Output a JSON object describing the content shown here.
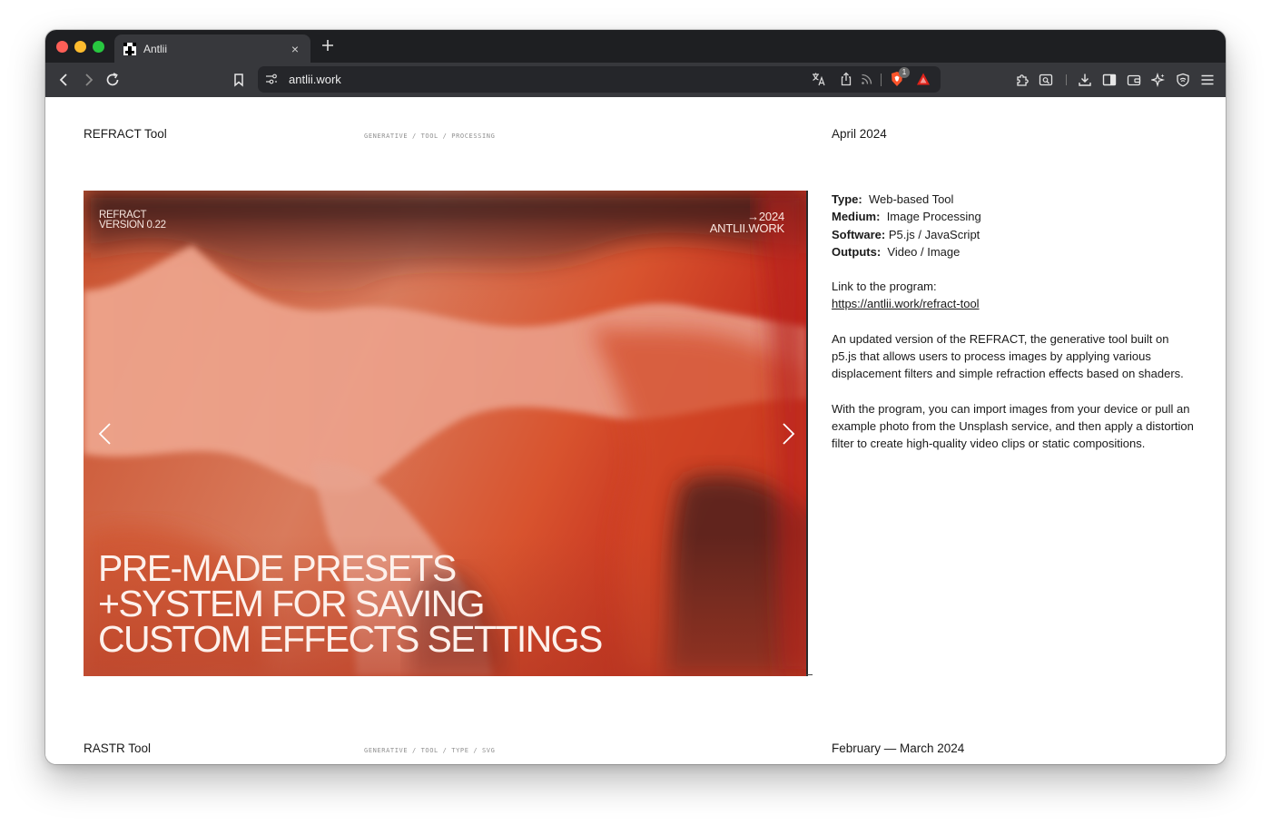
{
  "browser": {
    "tab_title": "Antlii",
    "tab_close": "×",
    "url": "antlii.work",
    "shields_badge": "1"
  },
  "projects": [
    {
      "title": "REFRACT Tool",
      "tags": "GENERATIVE / TOOL / PROCESSING",
      "date": "April 2024",
      "image": {
        "top_left_line1": "REFRACT",
        "top_left_line2": "VERSION 0.22",
        "top_right_line1": "→2024",
        "top_right_line2": "ANTLII.WORK",
        "headline_line1": "PRE-MADE PRESETS",
        "headline_line2": "+SYSTEM FOR SAVING",
        "headline_line3": "CUSTOM EFFECTS SETTINGS"
      },
      "specs": [
        {
          "label": "Type:",
          "value": "Web-based Tool"
        },
        {
          "label": "Medium:",
          "value": "Image Processing"
        },
        {
          "label": "Software:",
          "value": "P5.js / JavaScript"
        },
        {
          "label": "Outputs:",
          "value": "Video / Image"
        }
      ],
      "link_label": "Link to the program:",
      "link_url": "https://antlii.work/refract-tool",
      "description_1": "An updated version of the REFRACT, the generative tool built on p5.js that allows users to process images by applying various displacement filters and simple refraction effects based on shaders.",
      "description_2": "With the program, you can import images from your device or pull an example photo from the Unsplash service, and then apply a distortion filter to create high-quality video clips or static compositions."
    },
    {
      "title": "RASTR Tool",
      "tags": "GENERATIVE / TOOL / TYPE / SVG",
      "date": "February — March 2024"
    }
  ],
  "colors": {
    "accent_red": "#d8331f",
    "tabbar": "#1e1f22",
    "toolbar": "#37383c"
  }
}
